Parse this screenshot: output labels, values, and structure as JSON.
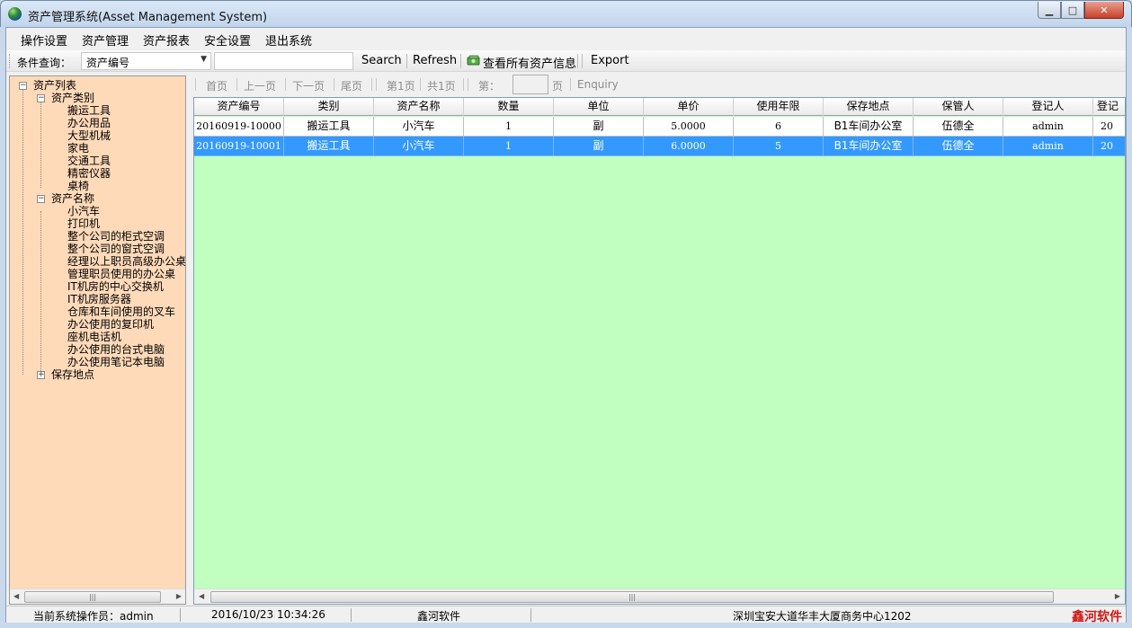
{
  "window": {
    "title": "资产管理系统(Asset Management System)",
    "min_label": "▭",
    "max_label": "□",
    "close_label": "✕"
  },
  "menu": [
    "操作设置",
    "资产管理",
    "资产报表",
    "安全设置",
    "退出系统"
  ],
  "toolbar": {
    "query_label": "条件查询：",
    "field_select": "资产编号",
    "search_value": "",
    "search": "Search",
    "refresh": "Refresh",
    "view_all": "查看所有资产信息",
    "export": "Export"
  },
  "pager": {
    "first": "首页",
    "prev": "上一页",
    "next": "下一页",
    "last": "尾页",
    "current_page": "第1页",
    "total_pages": "共1页",
    "goto_prefix": "第：",
    "goto_value": "",
    "goto_suffix": "页",
    "enquiry": "Enquiry"
  },
  "tree": {
    "root": "资产列表",
    "categories_label": "资产类别",
    "categories": [
      "搬运工具",
      "办公用品",
      "大型机械",
      "家电",
      "交通工具",
      "精密仪器",
      "桌椅"
    ],
    "names_label": "资产名称",
    "names": [
      "小汽车",
      "打印机",
      "整个公司的柜式空调",
      "整个公司的窗式空调",
      "经理以上职员高级办公桌",
      "管理职员使用的办公桌",
      "IT机房的中心交换机",
      "IT机房服务器",
      "仓库和车间使用的叉车",
      "办公使用的复印机",
      "座机电话机",
      "办公使用的台式电脑",
      "办公使用笔记本电脑"
    ],
    "locations_label": "保存地点"
  },
  "grid": {
    "columns": [
      "资产编号",
      "类别",
      "资产名称",
      "数量",
      "单位",
      "单价",
      "使用年限",
      "保存地点",
      "保管人",
      "登记人",
      "登记"
    ],
    "rows": [
      [
        "20160919-10000",
        "搬运工具",
        "小汽车",
        "1",
        "副",
        "5.0000",
        "6",
        "B1车间办公室",
        "伍德全",
        "admin",
        "20"
      ],
      [
        "20160919-10001",
        "搬运工具",
        "小汽车",
        "1",
        "副",
        "6.0000",
        "5",
        "B1车间办公室",
        "伍德全",
        "admin",
        "20"
      ]
    ],
    "selected_row": 1
  },
  "status": {
    "operator": "当前系统操作员：admin",
    "datetime": "2016/10/23 10:34:26",
    "company": "鑫河软件",
    "address": "深圳宝安大道华丰大厦商务中心1202",
    "brand": "鑫河软件"
  },
  "colors": {
    "tree_bg": "#ffdab9",
    "grid_bg": "#c0ffc0",
    "selection": "#3399ff",
    "brand": "#d01818"
  }
}
